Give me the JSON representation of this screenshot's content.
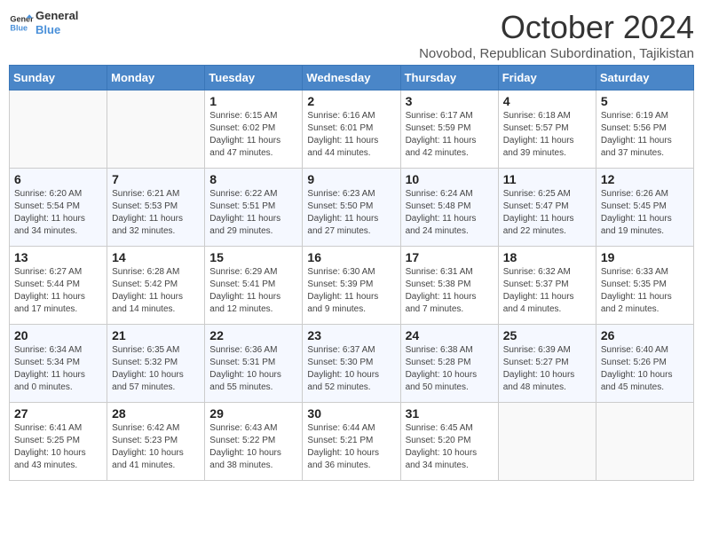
{
  "header": {
    "logo_general": "General",
    "logo_blue": "Blue",
    "month_title": "October 2024",
    "subtitle": "Novobod, Republican Subordination, Tajikistan"
  },
  "days_of_week": [
    "Sunday",
    "Monday",
    "Tuesday",
    "Wednesday",
    "Thursday",
    "Friday",
    "Saturday"
  ],
  "weeks": [
    [
      {
        "day": "",
        "info": ""
      },
      {
        "day": "",
        "info": ""
      },
      {
        "day": "1",
        "info": "Sunrise: 6:15 AM\nSunset: 6:02 PM\nDaylight: 11 hours and 47 minutes."
      },
      {
        "day": "2",
        "info": "Sunrise: 6:16 AM\nSunset: 6:01 PM\nDaylight: 11 hours and 44 minutes."
      },
      {
        "day": "3",
        "info": "Sunrise: 6:17 AM\nSunset: 5:59 PM\nDaylight: 11 hours and 42 minutes."
      },
      {
        "day": "4",
        "info": "Sunrise: 6:18 AM\nSunset: 5:57 PM\nDaylight: 11 hours and 39 minutes."
      },
      {
        "day": "5",
        "info": "Sunrise: 6:19 AM\nSunset: 5:56 PM\nDaylight: 11 hours and 37 minutes."
      }
    ],
    [
      {
        "day": "6",
        "info": "Sunrise: 6:20 AM\nSunset: 5:54 PM\nDaylight: 11 hours and 34 minutes."
      },
      {
        "day": "7",
        "info": "Sunrise: 6:21 AM\nSunset: 5:53 PM\nDaylight: 11 hours and 32 minutes."
      },
      {
        "day": "8",
        "info": "Sunrise: 6:22 AM\nSunset: 5:51 PM\nDaylight: 11 hours and 29 minutes."
      },
      {
        "day": "9",
        "info": "Sunrise: 6:23 AM\nSunset: 5:50 PM\nDaylight: 11 hours and 27 minutes."
      },
      {
        "day": "10",
        "info": "Sunrise: 6:24 AM\nSunset: 5:48 PM\nDaylight: 11 hours and 24 minutes."
      },
      {
        "day": "11",
        "info": "Sunrise: 6:25 AM\nSunset: 5:47 PM\nDaylight: 11 hours and 22 minutes."
      },
      {
        "day": "12",
        "info": "Sunrise: 6:26 AM\nSunset: 5:45 PM\nDaylight: 11 hours and 19 minutes."
      }
    ],
    [
      {
        "day": "13",
        "info": "Sunrise: 6:27 AM\nSunset: 5:44 PM\nDaylight: 11 hours and 17 minutes."
      },
      {
        "day": "14",
        "info": "Sunrise: 6:28 AM\nSunset: 5:42 PM\nDaylight: 11 hours and 14 minutes."
      },
      {
        "day": "15",
        "info": "Sunrise: 6:29 AM\nSunset: 5:41 PM\nDaylight: 11 hours and 12 minutes."
      },
      {
        "day": "16",
        "info": "Sunrise: 6:30 AM\nSunset: 5:39 PM\nDaylight: 11 hours and 9 minutes."
      },
      {
        "day": "17",
        "info": "Sunrise: 6:31 AM\nSunset: 5:38 PM\nDaylight: 11 hours and 7 minutes."
      },
      {
        "day": "18",
        "info": "Sunrise: 6:32 AM\nSunset: 5:37 PM\nDaylight: 11 hours and 4 minutes."
      },
      {
        "day": "19",
        "info": "Sunrise: 6:33 AM\nSunset: 5:35 PM\nDaylight: 11 hours and 2 minutes."
      }
    ],
    [
      {
        "day": "20",
        "info": "Sunrise: 6:34 AM\nSunset: 5:34 PM\nDaylight: 11 hours and 0 minutes."
      },
      {
        "day": "21",
        "info": "Sunrise: 6:35 AM\nSunset: 5:32 PM\nDaylight: 10 hours and 57 minutes."
      },
      {
        "day": "22",
        "info": "Sunrise: 6:36 AM\nSunset: 5:31 PM\nDaylight: 10 hours and 55 minutes."
      },
      {
        "day": "23",
        "info": "Sunrise: 6:37 AM\nSunset: 5:30 PM\nDaylight: 10 hours and 52 minutes."
      },
      {
        "day": "24",
        "info": "Sunrise: 6:38 AM\nSunset: 5:28 PM\nDaylight: 10 hours and 50 minutes."
      },
      {
        "day": "25",
        "info": "Sunrise: 6:39 AM\nSunset: 5:27 PM\nDaylight: 10 hours and 48 minutes."
      },
      {
        "day": "26",
        "info": "Sunrise: 6:40 AM\nSunset: 5:26 PM\nDaylight: 10 hours and 45 minutes."
      }
    ],
    [
      {
        "day": "27",
        "info": "Sunrise: 6:41 AM\nSunset: 5:25 PM\nDaylight: 10 hours and 43 minutes."
      },
      {
        "day": "28",
        "info": "Sunrise: 6:42 AM\nSunset: 5:23 PM\nDaylight: 10 hours and 41 minutes."
      },
      {
        "day": "29",
        "info": "Sunrise: 6:43 AM\nSunset: 5:22 PM\nDaylight: 10 hours and 38 minutes."
      },
      {
        "day": "30",
        "info": "Sunrise: 6:44 AM\nSunset: 5:21 PM\nDaylight: 10 hours and 36 minutes."
      },
      {
        "day": "31",
        "info": "Sunrise: 6:45 AM\nSunset: 5:20 PM\nDaylight: 10 hours and 34 minutes."
      },
      {
        "day": "",
        "info": ""
      },
      {
        "day": "",
        "info": ""
      }
    ]
  ]
}
